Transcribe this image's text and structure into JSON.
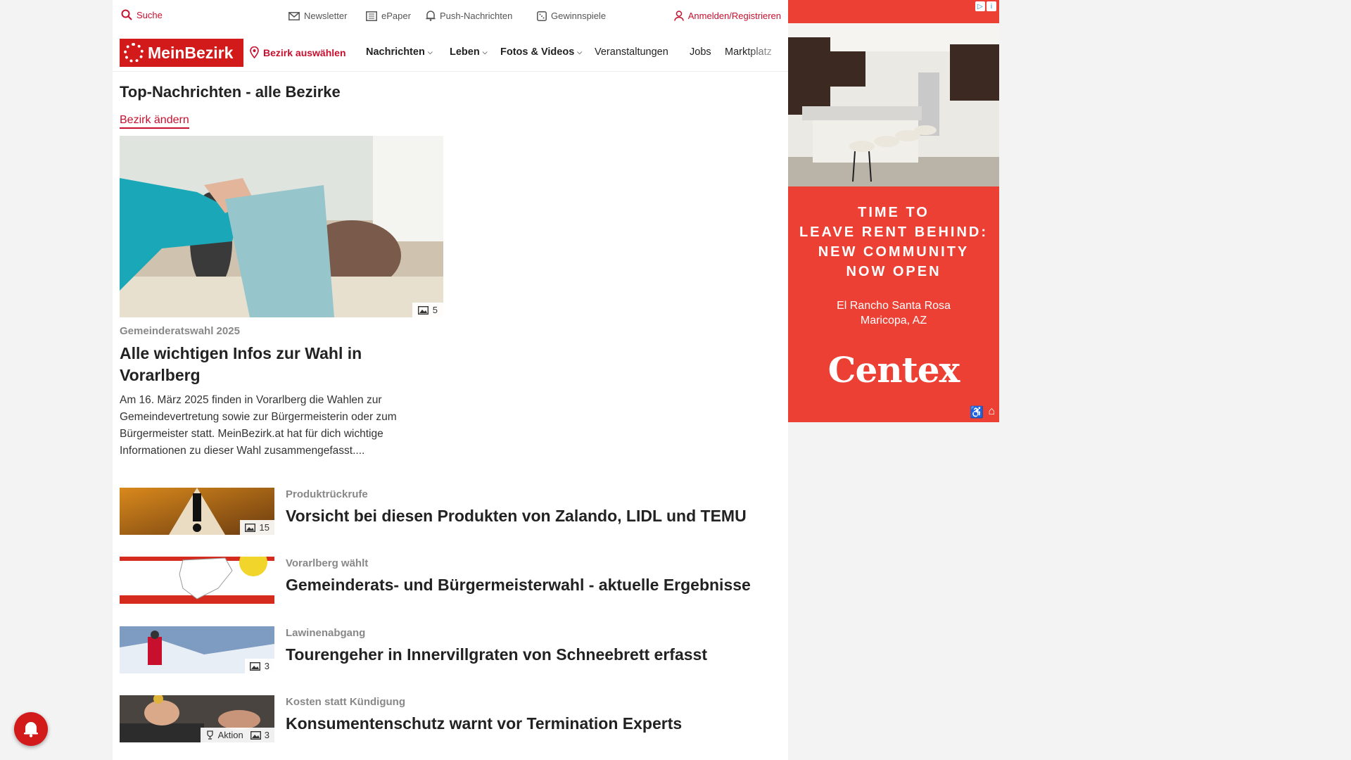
{
  "topbar": {
    "search": "Suche",
    "newsletter": "Newsletter",
    "epaper": "ePaper",
    "push": "Push-Nachrichten",
    "gewinnspiele": "Gewinnspiele",
    "login": "Anmelden/Registrieren"
  },
  "nav": {
    "logo": "MeinBezirk",
    "bezirk": "Bezirk auswählen",
    "items": [
      "Nachrichten",
      "Leben",
      "Fotos & Videos",
      "Veranstaltungen",
      "Jobs",
      "Marktplatz"
    ]
  },
  "section": {
    "title": "Top-Nachrichten - alle Bezirke",
    "change": "Bezirk ändern"
  },
  "lead": {
    "image_count": "5",
    "kicker": "Gemeinderatswahl 2025",
    "title": "Alle wichtigen Infos zur Wahl in Vorarlberg",
    "text": "Am 16. März 2025 finden in Vorarlberg die Wahlen zur Gemeindevertretung sowie zur Bürgermeisterin oder zum Bürgermeister statt. MeinBezirk.at hat für dich wichtige Informationen zu dieser Wahl zusammengefasst...."
  },
  "articles": [
    {
      "kicker": "Produktrückrufe",
      "title": "Vorsicht bei diesen Produkten von Zalando, LIDL und TEMU",
      "image_count": "15"
    },
    {
      "kicker": "Vorarlberg wählt",
      "title": "Gemeinderats- und Bürgermeisterwahl - aktuelle Ergebnisse",
      "image_count": ""
    },
    {
      "kicker": "Lawinenabgang",
      "title": "Tourengeher in Innervillgraten von Schneebrett erfasst",
      "image_count": "3"
    },
    {
      "kicker": "Kosten statt Kündigung",
      "title": "Konsumentenschutz warnt vor Termination Experts",
      "image_count": "3",
      "tag": "Aktion"
    }
  ],
  "ad": {
    "headline_lines": [
      "TIME TO",
      "LEAVE RENT BEHIND:",
      "NEW COMMUNITY",
      "NOW OPEN"
    ],
    "location_lines": [
      "El Rancho Santa Rosa",
      "Maricopa, AZ"
    ],
    "brand": "Centex",
    "brand_color": "#ed4035"
  },
  "colors": {
    "accent": "#c8102e",
    "logo_bg": "#d31a1a"
  }
}
